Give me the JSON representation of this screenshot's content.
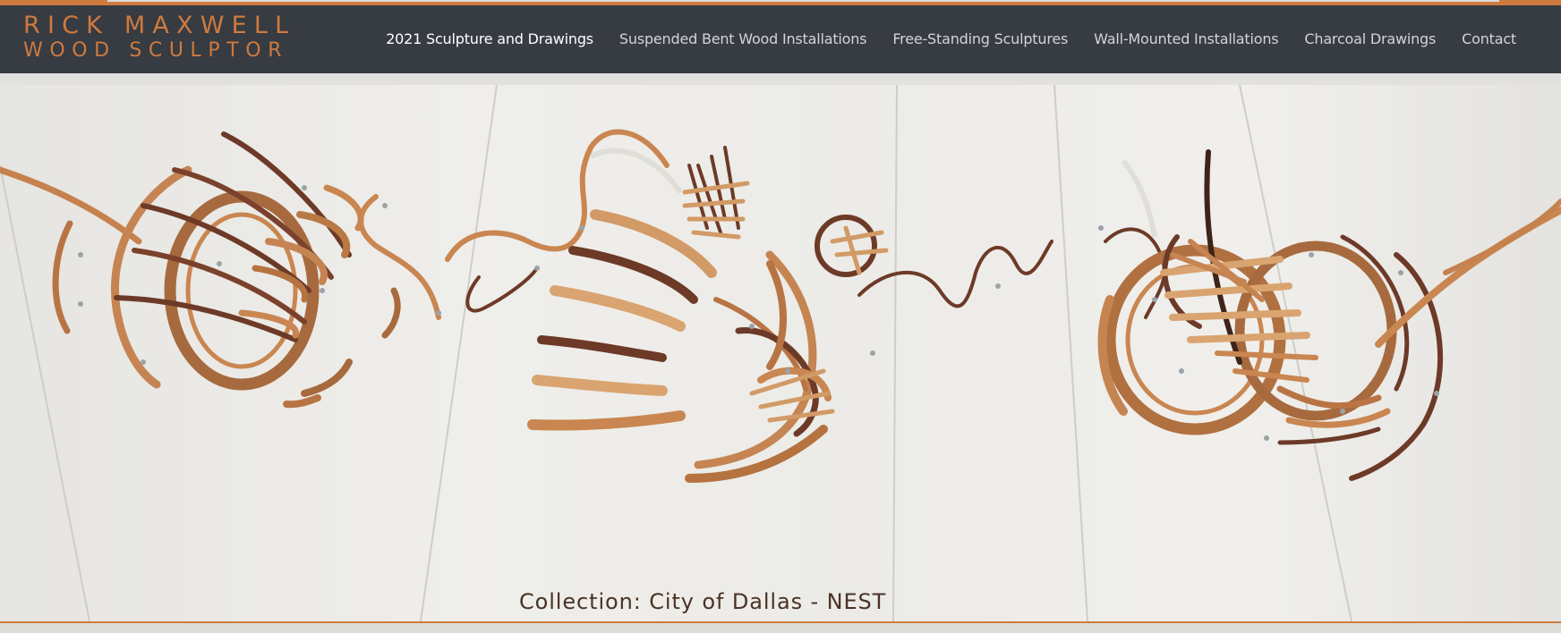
{
  "site": {
    "logo_line1": "RICK MAXWELL",
    "logo_line2": "WOOD SCULPTOR"
  },
  "nav": {
    "items": [
      {
        "label": "2021 Sculpture and Drawings",
        "active": true
      },
      {
        "label": "Suspended Bent Wood Installations",
        "active": false
      },
      {
        "label": "Free-Standing Sculptures",
        "active": false
      },
      {
        "label": "Wall-Mounted Installations",
        "active": false
      },
      {
        "label": "Charcoal Drawings",
        "active": false
      },
      {
        "label": "Contact",
        "active": false
      }
    ]
  },
  "hero": {
    "caption": "Collection: City of Dallas - NEST"
  },
  "colors": {
    "accent": "#cf7a3e",
    "header_bg": "#373b42",
    "nav_text": "#d2d4d8",
    "caption_text": "#4a3226",
    "wood_light": "#c98650",
    "wood_dark": "#5a3222"
  }
}
